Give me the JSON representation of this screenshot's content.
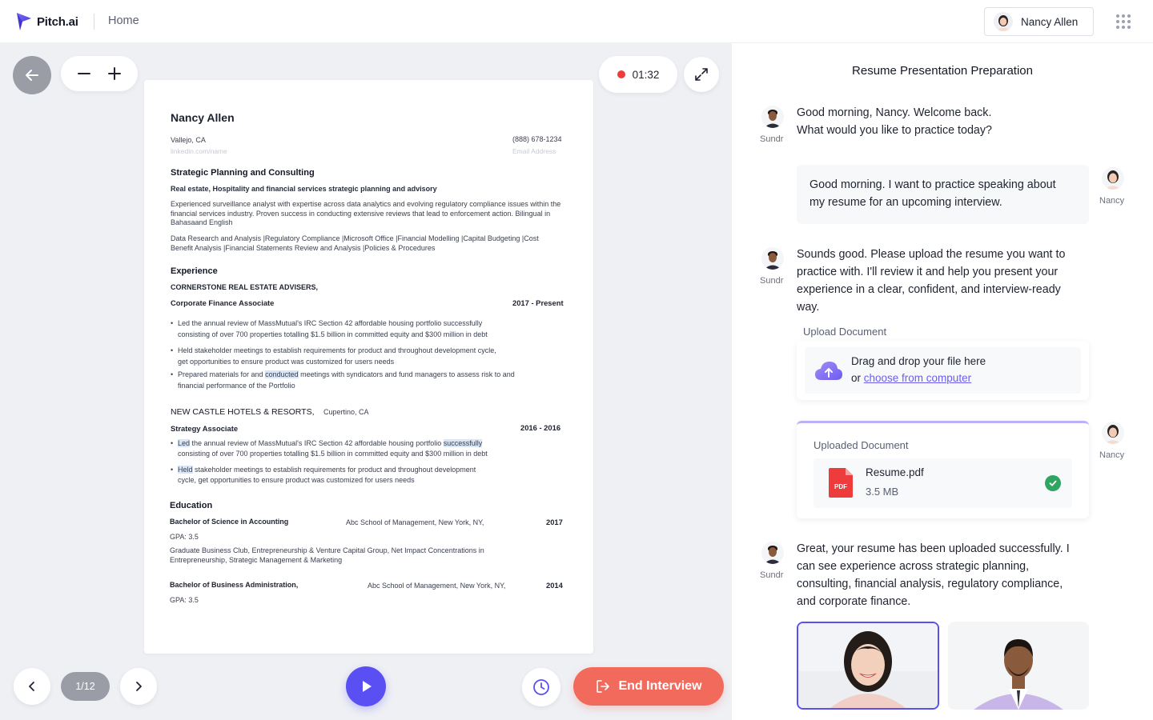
{
  "app": {
    "brand": "Pitch.ai",
    "nav_home": "Home",
    "user_name": "Nancy Allen"
  },
  "stage": {
    "timer": "01:32",
    "page_indicator": "1/12",
    "end_button": "End Interview"
  },
  "resume": {
    "name": "Nancy Allen",
    "location": "Vallejo, CA",
    "linkedin": "linkedin.com/name",
    "phone": "(888) 678-1234",
    "email": "Email Address",
    "headline": "Strategic Planning and Consulting",
    "subheadline": "Real estate, Hospitality and financial services strategic planning and advisory",
    "summary": "Experienced surveillance analyst with expertise across data analytics and evolving regulatory compliance issues within the financial services industry. Proven success in conducting extensive reviews that lead to enforcement action. Bilingual in Bahasaand English",
    "skills": "Data Research and Analysis |Regulatory Compliance |Microsoft Office |Financial Modelling |Capital Budgeting |Cost Benefit Analysis |Financial Statements Review and Analysis |Policies & Procedures",
    "experience_heading": "Experience",
    "job1": {
      "company": "CORNERSTONE REAL ESTATE ADVISERS,",
      "title": "Corporate Finance Associate",
      "dates": "2017 - Present",
      "b1_l1": "Led the annual review of MassMutual's IRC Section 42 affordable housing portfolio successfully",
      "b1_l2": "consisting of over 700 properties totalling $1.5 billion in committed equity and $300 million in debt",
      "b2_l1": "Held stakeholder meetings to establish requirements for product and throughout development cycle,",
      "b2_l2": "get opportunities to ensure  product was customized for users needs",
      "b3_pre": "Prepared materials for and ",
      "b3_hl": "conducted",
      "b3_post": " meetings with syndicators and fund managers to assess risk to and",
      "b3_l2": "financial performance of the Portfolio"
    },
    "job2": {
      "company": "NEW CASTLE HOTELS & RESORTS,",
      "location": "Cupertino, CA",
      "title": "Strategy Associate",
      "dates": "2016 - 2016",
      "b1_hl1": "Led",
      "b1_mid": " the annual review of MassMutual's IRC Section 42 affordable housing portfolio ",
      "b1_hl2": "successfully",
      "b1_l2": "consisting of over 700 properties totalling $1.5 billion in committed equity and $300 million in debt",
      "b2_hl": "Held",
      "b2_rest": " stakeholder meetings to establish requirements for product and throughout development",
      "b2_l2": "cycle, get opportunities to ensure  product was customized for users needs"
    },
    "education_heading": "Education",
    "edu1": {
      "degree": "Bachelor of Science in Accounting",
      "school": "Abc School of Management, New York, NY,",
      "year": "2017",
      "gpa": "GPA: 3.5",
      "activities": "Graduate Business Club, Entrepreneurship & Venture Capital Group, Net Impact Concentrations in Entrepreneurship, Strategic Management & Marketing"
    },
    "edu2": {
      "degree": "Bachelor of Business Administration,",
      "school": "Abc School of Management, New York, NY,",
      "year": "2014",
      "gpa": "GPA: 3.5"
    }
  },
  "chat": {
    "title": "Resume Presentation Preparation",
    "ai_label": "Sundr",
    "user_label": "Nancy",
    "m1_l1": "Good morning, Nancy. Welcome back.",
    "m1_l2": "What would you like to practice today?",
    "m2_l1": "Good morning. I want to practice speaking about",
    "m2_l2": "my resume for an upcoming interview.",
    "m3_l1": "Sounds good. Please upload the resume you want to",
    "m3_l2": "practice with. I'll review it and help you present your",
    "m3_l3": "experience in a clear, confident, and interview-ready",
    "m3_l4": "way.",
    "upload_label": "Upload Document",
    "drag_text": "Drag and drop your file here",
    "or_text": "or ",
    "choose_link": "choose from computer",
    "uploaded_label": "Uploaded Document",
    "file_name": "Resume.pdf",
    "file_size": "3.5 MB",
    "file_badge": "PDF",
    "m4_l1": "Great, your resume has been uploaded successfully. I",
    "m4_l2": "can see experience across strategic planning,",
    "m4_l3": "consulting, financial analysis, regulatory compliance,",
    "m4_l4": "and corporate finance."
  },
  "colors": {
    "accent": "#5a4ff2",
    "end_button": "#f26a5c",
    "recording": "#ee3b3b",
    "success": "#2fa562",
    "stage_bg": "#eef0f4"
  },
  "icons": [
    "logo-mark",
    "apps-grid-icon",
    "back-arrow-icon",
    "minus-icon",
    "plus-icon",
    "record-dot-icon",
    "expand-icon",
    "chevron-left-icon",
    "chevron-right-icon",
    "play-icon",
    "history-icon",
    "exit-icon",
    "cloud-upload-icon",
    "pdf-file-icon",
    "check-circle-icon"
  ]
}
